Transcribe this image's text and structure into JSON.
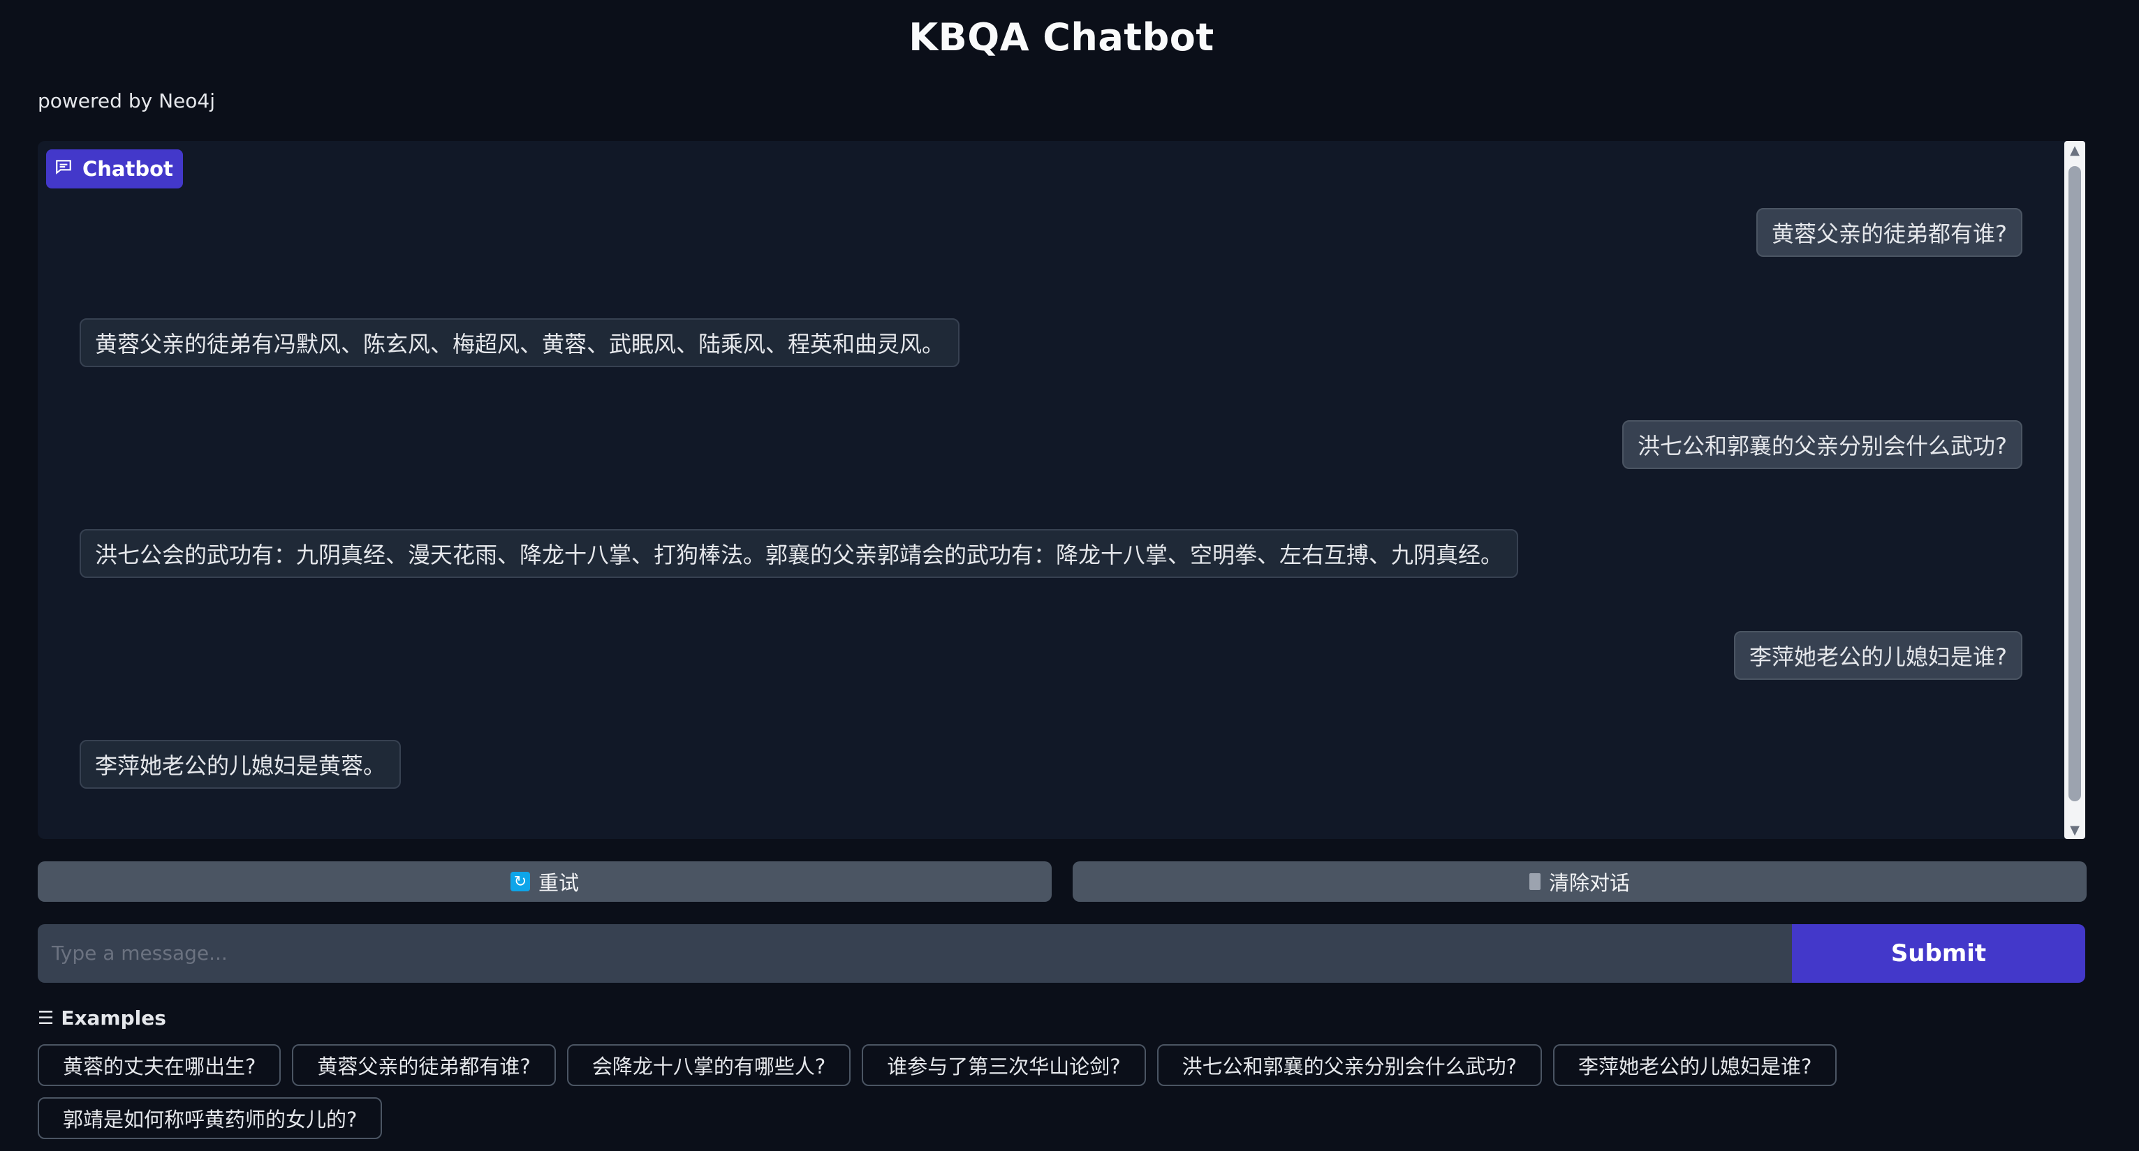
{
  "header": {
    "title": "KBQA Chatbot",
    "subtitle": "powered by Neo4j"
  },
  "chat": {
    "label": "Chatbot",
    "messages": [
      {
        "role": "user",
        "text": "黄蓉父亲的徒弟都有谁?"
      },
      {
        "role": "bot",
        "text": "黄蓉父亲的徒弟有冯默风、陈玄风、梅超风、黄蓉、武眠风、陆乘风、程英和曲灵风。"
      },
      {
        "role": "user",
        "text": "洪七公和郭襄的父亲分别会什么武功?"
      },
      {
        "role": "bot",
        "text": "洪七公会的武功有：九阴真经、漫天花雨、降龙十八掌、打狗棒法。郭襄的父亲郭靖会的武功有：降龙十八掌、空明拳、左右互搏、九阴真经。"
      },
      {
        "role": "user",
        "text": "李萍她老公的儿媳妇是谁?"
      },
      {
        "role": "bot",
        "text": "李萍她老公的儿媳妇是黄蓉。"
      }
    ]
  },
  "actions": {
    "retry_label": "重试",
    "clear_label": "清除对话"
  },
  "input": {
    "placeholder": "Type a message...",
    "value": "",
    "submit_label": "Submit"
  },
  "examples": {
    "label": "Examples",
    "items": [
      "黄蓉的丈夫在哪出生?",
      "黄蓉父亲的徒弟都有谁?",
      "会降龙十八掌的有哪些人?",
      "谁参与了第三次华山论剑?",
      "洪七公和郭襄的父亲分别会什么武功?",
      "李萍她老公的儿媳妇是谁?",
      "郭靖是如何称呼黄药师的女儿的?"
    ]
  },
  "colors": {
    "background": "#0b0f19",
    "panel": "#111827",
    "accent": "#4338ca",
    "button": "#4b5563"
  }
}
